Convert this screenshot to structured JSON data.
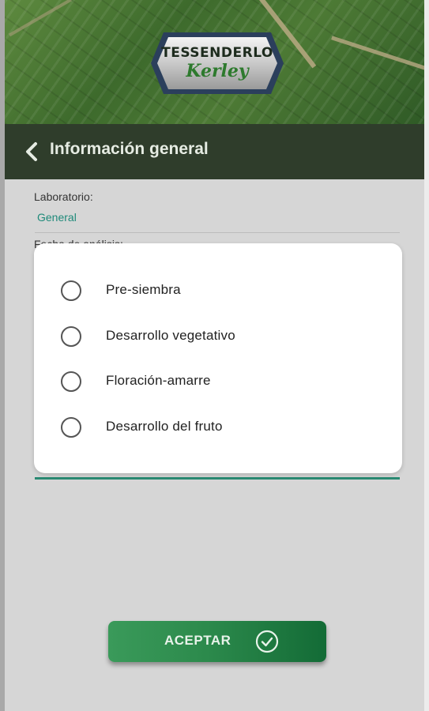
{
  "header": {
    "logo_line1": "TESSENDERLO",
    "logo_line2": "Kerley",
    "title": "Información general",
    "back_icon": "chevron-left-icon"
  },
  "form": {
    "laboratorio_label": "Laboratorio:",
    "laboratorio_value": "General",
    "fecha_label": "Fecha de análisis:"
  },
  "dialog": {
    "options": [
      {
        "label": "Pre-siembra",
        "selected": false
      },
      {
        "label": "Desarrollo vegetativo",
        "selected": false
      },
      {
        "label": "Floración-amarre",
        "selected": false
      },
      {
        "label": "Desarrollo del fruto",
        "selected": false
      }
    ]
  },
  "footer": {
    "accept_label": "ACEPTAR",
    "accept_icon": "check-circle-icon"
  },
  "colors": {
    "topbar": "#2f3d2b",
    "accent": "#2a8a73",
    "button": "#2c8a4c"
  }
}
